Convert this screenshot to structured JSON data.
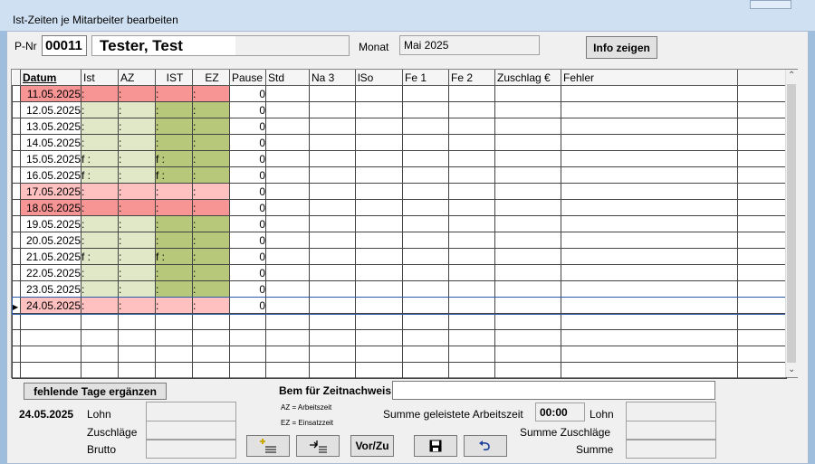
{
  "window": {
    "title": "Ist-Zeiten je Mitarbeiter bearbeiten"
  },
  "header": {
    "pnr_label": "P-Nr",
    "pnr_value": "00011",
    "name": "Tester, Test",
    "monat_label": "Monat",
    "monat_value": "Mai 2025",
    "info_button": "Info zeigen"
  },
  "grid": {
    "columns": [
      "Datum",
      "Ist",
      "AZ",
      "IST",
      "EZ",
      "Pause",
      "Std",
      "Na 3",
      "lSo",
      "Fe 1",
      "Fe 2",
      "Zuschlag €",
      "Fehler"
    ],
    "rows": [
      {
        "date": "11.05.2025",
        "ist": ":",
        "az": ":",
        "ist2": ":",
        "ez": ":",
        "pause": "0",
        "scheme": "red"
      },
      {
        "date": "12.05.2025",
        "ist": ":",
        "az": ":",
        "ist2": ":",
        "ez": ":",
        "pause": "0",
        "scheme": "green"
      },
      {
        "date": "13.05.2025",
        "ist": ":",
        "az": ":",
        "ist2": ":",
        "ez": ":",
        "pause": "0",
        "scheme": "green"
      },
      {
        "date": "14.05.2025",
        "ist": ":",
        "az": ":",
        "ist2": ":",
        "ez": ":",
        "pause": "0",
        "scheme": "green"
      },
      {
        "date": "15.05.2025",
        "ist": "f :",
        "az": ":",
        "ist2": "f :",
        "ez": ":",
        "pause": "0",
        "scheme": "green"
      },
      {
        "date": "16.05.2025",
        "ist": "f :",
        "az": ":",
        "ist2": "f :",
        "ez": ":",
        "pause": "0",
        "scheme": "green"
      },
      {
        "date": "17.05.2025",
        "ist": ":",
        "az": ":",
        "ist2": ":",
        "ez": ":",
        "pause": "0",
        "scheme": "pink"
      },
      {
        "date": "18.05.2025",
        "ist": ":",
        "az": ":",
        "ist2": ":",
        "ez": ":",
        "pause": "0",
        "scheme": "red"
      },
      {
        "date": "19.05.2025",
        "ist": ":",
        "az": ":",
        "ist2": ":",
        "ez": ":",
        "pause": "0",
        "scheme": "green"
      },
      {
        "date": "20.05.2025",
        "ist": ":",
        "az": ":",
        "ist2": ":",
        "ez": ":",
        "pause": "0",
        "scheme": "green"
      },
      {
        "date": "21.05.2025",
        "ist": "f :",
        "az": ":",
        "ist2": "f :",
        "ez": ":",
        "pause": "0",
        "scheme": "green"
      },
      {
        "date": "22.05.2025",
        "ist": ":",
        "az": ":",
        "ist2": ":",
        "ez": ":",
        "pause": "0",
        "scheme": "green"
      },
      {
        "date": "23.05.2025",
        "ist": ":",
        "az": ":",
        "ist2": ":",
        "ez": ":",
        "pause": "0",
        "scheme": "green"
      },
      {
        "date": "24.05.2025",
        "ist": ":",
        "az": ":",
        "ist2": ":",
        "ez": ":",
        "pause": "0",
        "scheme": "pink"
      }
    ],
    "empty_rows": 4
  },
  "footer": {
    "fehlende_button": "fehlende Tage ergänzen",
    "bem_label": "Bem für Zeitnachweis",
    "legend_az": "AZ = Arbeitszeit",
    "legend_ez": "EZ = Einsatzzeit",
    "date": "24.05.2025",
    "lohn_label": "Lohn",
    "zuschlaege_label": "Zuschläge",
    "brutto_label": "Brutto",
    "summe_arbeitszeit_label": "Summe geleistete Arbeitszeit",
    "summe_arbeitszeit_value": "00:00",
    "lohn_right_label": "Lohn",
    "summe_zuschlaege_label": "Summe Zuschläge",
    "summe_label": "Summe",
    "vorzu_button": "Vor/Zu"
  },
  "icons": {
    "add_row": "add-row-icon",
    "insert": "insert-row-icon",
    "save": "floppy-disk-icon",
    "undo": "undo-icon"
  },
  "colors": {
    "weekend_red": "#f79494",
    "weekend_pink": "#ffc0c0",
    "light_green": "#e0e8c8",
    "olive_green": "#b8c87a"
  }
}
